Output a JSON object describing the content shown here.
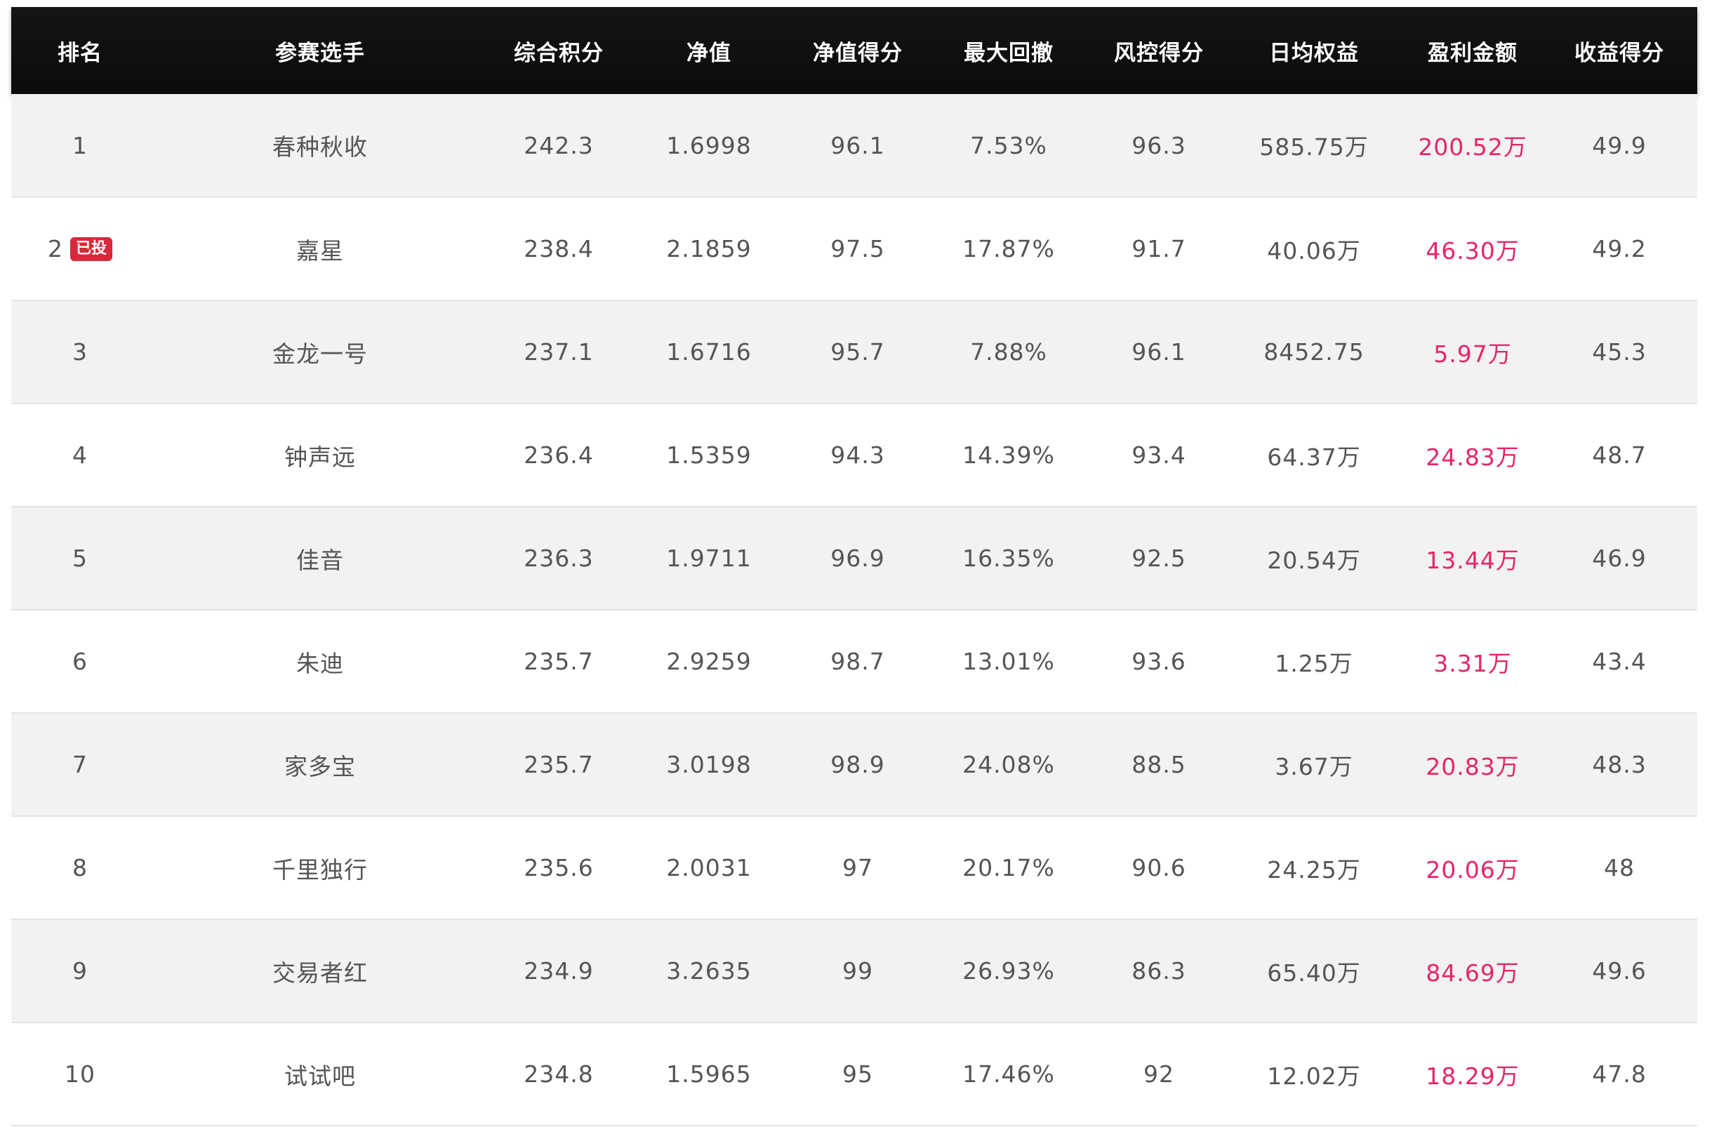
{
  "table": {
    "headers": {
      "rank": "排名",
      "player": "参赛选手",
      "score": "综合积分",
      "nav": "净值",
      "nav_score": "净值得分",
      "drawdown": "最大回撤",
      "risk_score": "风控得分",
      "equity": "日均权益",
      "profit": "盈利金额",
      "return_score": "收益得分"
    },
    "rows": [
      {
        "rank": "1",
        "badge": "",
        "player": "春种秋收",
        "score": "242.3",
        "nav": "1.6998",
        "nav_score": "96.1",
        "drawdown": "7.53%",
        "risk_score": "96.3",
        "equity": "585.75万",
        "profit": "200.52万",
        "return_score": "49.9"
      },
      {
        "rank": "2",
        "badge": "已投",
        "player": "嘉星",
        "score": "238.4",
        "nav": "2.1859",
        "nav_score": "97.5",
        "drawdown": "17.87%",
        "risk_score": "91.7",
        "equity": "40.06万",
        "profit": "46.30万",
        "return_score": "49.2"
      },
      {
        "rank": "3",
        "badge": "",
        "player": "金龙一号",
        "score": "237.1",
        "nav": "1.6716",
        "nav_score": "95.7",
        "drawdown": "7.88%",
        "risk_score": "96.1",
        "equity": "8452.75",
        "profit": "5.97万",
        "return_score": "45.3"
      },
      {
        "rank": "4",
        "badge": "",
        "player": "钟声远",
        "score": "236.4",
        "nav": "1.5359",
        "nav_score": "94.3",
        "drawdown": "14.39%",
        "risk_score": "93.4",
        "equity": "64.37万",
        "profit": "24.83万",
        "return_score": "48.7"
      },
      {
        "rank": "5",
        "badge": "",
        "player": "佳音",
        "score": "236.3",
        "nav": "1.9711",
        "nav_score": "96.9",
        "drawdown": "16.35%",
        "risk_score": "92.5",
        "equity": "20.54万",
        "profit": "13.44万",
        "return_score": "46.9"
      },
      {
        "rank": "6",
        "badge": "",
        "player": "朱迪",
        "score": "235.7",
        "nav": "2.9259",
        "nav_score": "98.7",
        "drawdown": "13.01%",
        "risk_score": "93.6",
        "equity": "1.25万",
        "profit": "3.31万",
        "return_score": "43.4"
      },
      {
        "rank": "7",
        "badge": "",
        "player": "家多宝",
        "score": "235.7",
        "nav": "3.0198",
        "nav_score": "98.9",
        "drawdown": "24.08%",
        "risk_score": "88.5",
        "equity": "3.67万",
        "profit": "20.83万",
        "return_score": "48.3"
      },
      {
        "rank": "8",
        "badge": "",
        "player": "千里独行",
        "score": "235.6",
        "nav": "2.0031",
        "nav_score": "97",
        "drawdown": "20.17%",
        "risk_score": "90.6",
        "equity": "24.25万",
        "profit": "20.06万",
        "return_score": "48"
      },
      {
        "rank": "9",
        "badge": "",
        "player": "交易者红",
        "score": "234.9",
        "nav": "3.2635",
        "nav_score": "99",
        "drawdown": "26.93%",
        "risk_score": "86.3",
        "equity": "65.40万",
        "profit": "84.69万",
        "return_score": "49.6"
      },
      {
        "rank": "10",
        "badge": "",
        "player": "试试吧",
        "score": "234.8",
        "nav": "1.5965",
        "nav_score": "95",
        "drawdown": "17.46%",
        "risk_score": "92",
        "equity": "12.02万",
        "profit": "18.29万",
        "return_score": "47.8"
      }
    ]
  },
  "colors": {
    "header_bg": "#111111",
    "profit_text": "#e8246b",
    "badge_bg": "#d9283a",
    "row_alt_bg": "#f2f2f2"
  }
}
